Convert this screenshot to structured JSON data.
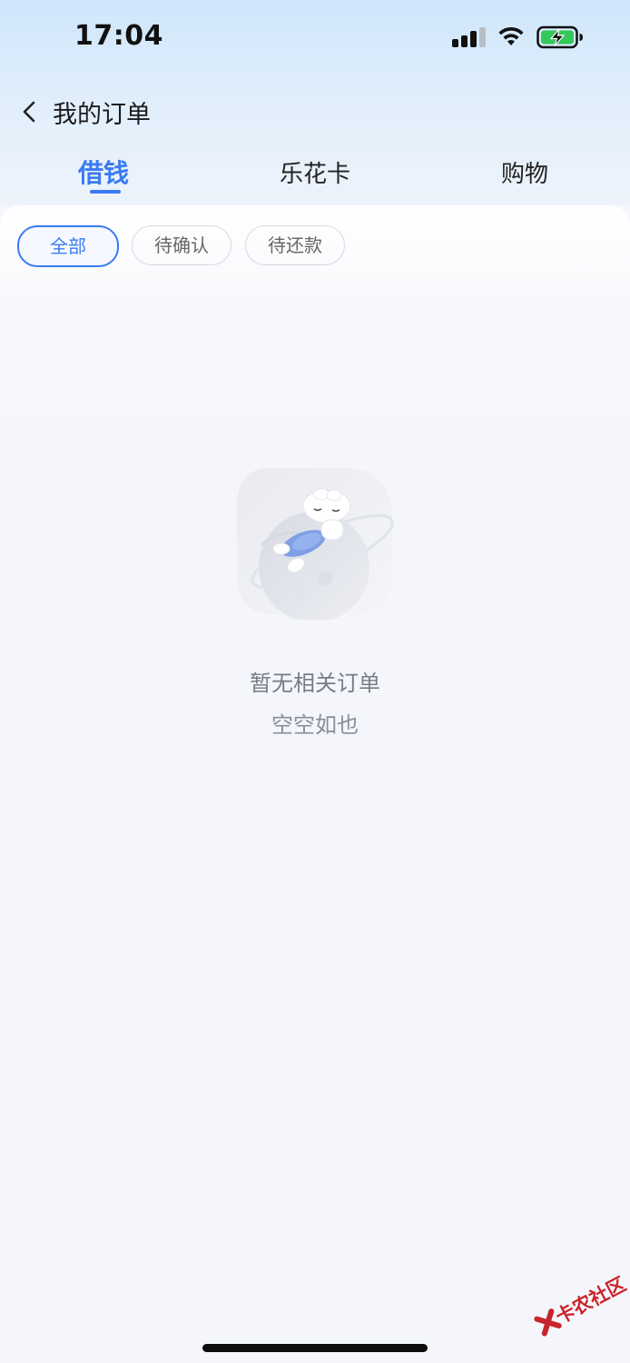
{
  "status_bar": {
    "time": "17:04"
  },
  "header": {
    "title": "我的订单"
  },
  "tabs": [
    {
      "label": "借钱",
      "active": true
    },
    {
      "label": "乐花卡",
      "active": false
    },
    {
      "label": "购物",
      "active": false
    }
  ],
  "filters": [
    {
      "label": "全部",
      "active": true
    },
    {
      "label": "待确认",
      "active": false
    },
    {
      "label": "待还款",
      "active": false
    }
  ],
  "empty_state": {
    "title": "暂无相关订单",
    "subtitle": "空空如也",
    "illustration": "astronaut-rabbit-on-planet"
  },
  "watermark": {
    "text": "卡农社区"
  },
  "colors": {
    "accent": "#3b7bf2",
    "text_primary": "#1c1c1e",
    "text_secondary": "#777b85"
  }
}
